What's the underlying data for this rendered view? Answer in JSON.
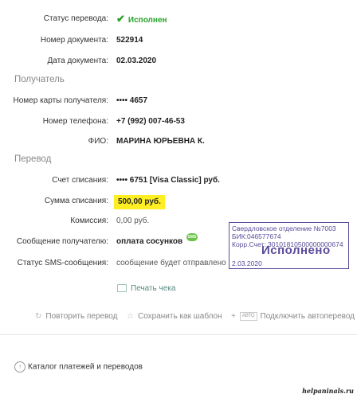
{
  "details": {
    "status_label": "Статус перевода:",
    "status_value": "Исполнен",
    "doc_number_label": "Номер документа:",
    "doc_number_value": "522914",
    "doc_date_label": "Дата документа:",
    "doc_date_value": "02.03.2020"
  },
  "recipient": {
    "section_title": "Получатель",
    "card_label": "Номер карты получателя:",
    "card_value": "•••• 4657",
    "phone_label": "Номер телефона:",
    "phone_value": "+7 (992) 007-46-53",
    "name_label": "ФИО:",
    "name_value": "МАРИНА ЮРЬЕВНА К."
  },
  "transfer": {
    "section_title": "Перевод",
    "account_label": "Счет списания:",
    "account_value": "•••• 6751  [Visa Classic]  руб.",
    "amount_label": "Сумма списания:",
    "amount_value": "500,00  руб.",
    "fee_label": "Комиссия:",
    "fee_value": "0,00 руб.",
    "message_label": "Сообщение получателю:",
    "message_value": "оплата сосунков",
    "sms_badge": "SMS",
    "sms_status_label": "Статус SMS-сообщения:",
    "sms_status_value": "сообщение будет отправлено"
  },
  "stamp": {
    "line1": "Свердловское отделение №7003",
    "line2": "БИК:046577674",
    "line3": "Корр.Счет: 30101810500000000674",
    "big": "Исполнено",
    "date": "2.03.2020"
  },
  "actions": {
    "print": "Печать чека",
    "repeat": "Повторить перевод",
    "save_template": "Сохранить как шаблон",
    "auto_badge": "АВТО",
    "autotransfer": "Подключить автоперевод"
  },
  "footer": {
    "catalog": "Каталог платежей и переводов",
    "watermark": "helpaninals.ru"
  }
}
